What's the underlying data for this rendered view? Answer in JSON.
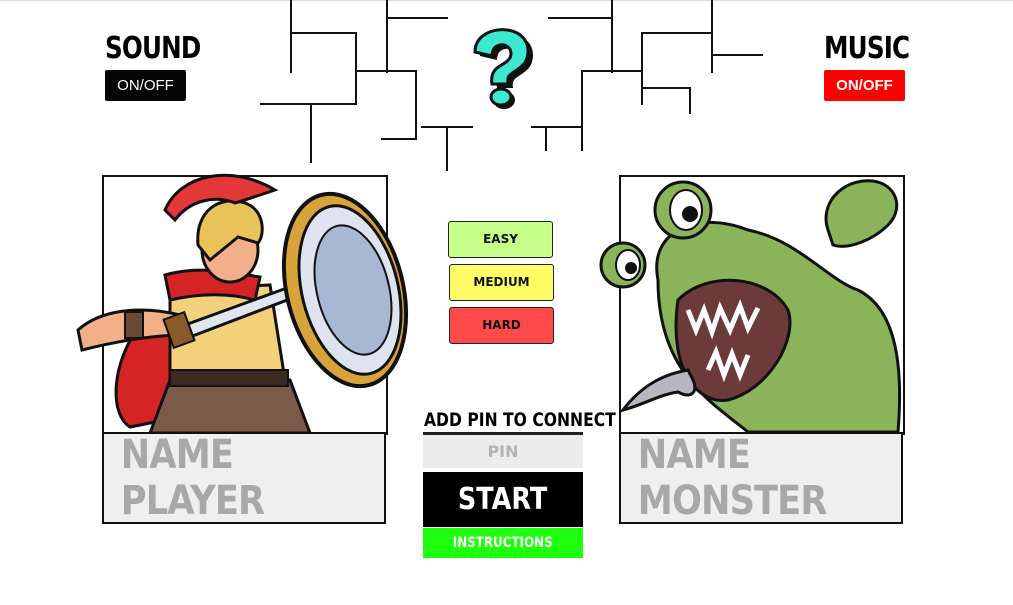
{
  "sound": {
    "title": "SOUND",
    "toggle_label": "ON/OFF"
  },
  "music": {
    "title": "MUSIC",
    "toggle_label": "ON/OFF"
  },
  "logo": {
    "glyph": "?",
    "color": "#3de8d0"
  },
  "player": {
    "name_placeholder": "NAME PLAYER"
  },
  "monster": {
    "name_placeholder": "NAME MONSTER"
  },
  "difficulty": {
    "easy": "EASY",
    "medium": "MEDIUM",
    "hard": "HARD"
  },
  "connect": {
    "label": "ADD PIN TO CONNECT",
    "pin_placeholder": "PIN"
  },
  "start_label": "START",
  "instructions_label": "INSTRUCTIONS",
  "colors": {
    "easy": "#c6ff8a",
    "medium": "#fffd66",
    "hard": "#ff4a4a",
    "start": "#000000",
    "instructions": "#1dff0d",
    "music_toggle": "#fe0000",
    "sound_toggle": "#050505"
  }
}
